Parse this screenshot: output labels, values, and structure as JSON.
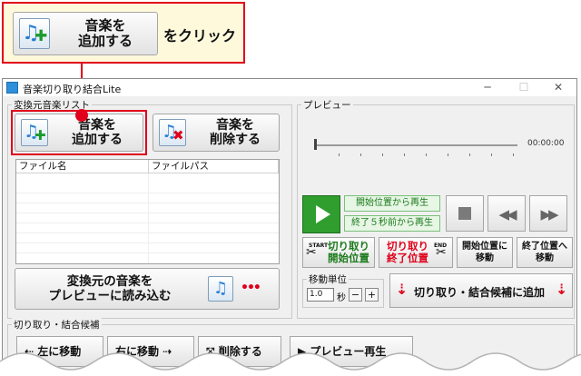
{
  "callout": {
    "button_label": "音楽を\n追加する",
    "instruction": "をクリック"
  },
  "window": {
    "title": "音楽切り取り結合Lite",
    "min_glyph": "─",
    "max_glyph": "☐",
    "close_glyph": "✕"
  },
  "source_list": {
    "legend": "変換元音楽リスト",
    "add_label": "音楽を\n追加する",
    "remove_label": "音楽を\n削除する",
    "col_filename": "ファイル名",
    "col_filepath": "ファイルパス",
    "load_preview_label": "変換元の音楽を\nプレビューに読み込む",
    "dots_glyph": "•••"
  },
  "preview": {
    "legend": "プレビュー",
    "time": "00:00:00",
    "play_from_start": "開始位置から再生",
    "play_5s_before_end": "終了５秒前から再生",
    "rewind_glyph": "◀◀",
    "forward_glyph": "▶▶",
    "cut_start_label": "切り取り\n開始位置",
    "cut_end_label": "切り取り\n終了位置",
    "start_tag": "START",
    "end_tag": "END",
    "scissor_glyph": "✂",
    "move_to_start": "開始位置に\n移動",
    "move_to_end": "終了位置へ\n移動",
    "step_legend": "移動単位",
    "step_value": "1.0",
    "step_unit": "秒",
    "minus": "−",
    "plus": "+",
    "add_candidate": "切り取り・結合候補に追加",
    "arrow_glyph": "⇣"
  },
  "candidates": {
    "legend": "切り取り・結合候補",
    "move_left": "左に移動",
    "move_right": "右に移動",
    "delete": "削除する",
    "preview_play": "▶ プレビュー再生",
    "move_left_glyph": "⇠",
    "move_right_glyph": "⇢",
    "delete_glyph": "⤧"
  },
  "icons": {
    "note": "♫",
    "plus": "✚",
    "cross": "✖"
  },
  "colors": {
    "accent_red": "#e0001b",
    "callout_bg": "#fff9dc",
    "play_green": "#2f9e2f",
    "icon_blue": "#2a7fd4"
  }
}
